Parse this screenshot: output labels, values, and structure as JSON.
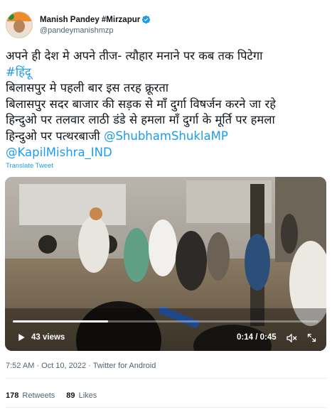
{
  "author": {
    "display_name": "Manish Pandey #Mirzapur",
    "handle": "@pandeymanishmzp",
    "verified_icon": "verified-badge-icon",
    "verified_color": "#1d9bf0"
  },
  "tweet": {
    "line1": "अपने ही देश मे अपने तीज- त्यौहार मनाने पर कब तक पिटेगा",
    "hashtag": "#हिंदू",
    "line3": "बिलासपुर मे पहली बार इस तरह क्रूरता",
    "line4": "बिलासपुर सदर बाजार की सड़क से माँ दुर्गा विषर्जन करने जा रहे",
    "line5": "हिन्दुओ पर तलवार लाठी डंडे से हमला माँ दुर्गा के मूर्ति पर हमला",
    "line6_text": "हिन्दुओ पर पत्थरबाजी ",
    "mention1": "@ShubhamShuklaMP",
    "mention2": "@KapilMishra_IND",
    "translate_label": "Translate Tweet",
    "link_color": "#1d9bf0"
  },
  "video": {
    "views": "43 views",
    "time": "0:14 / 0:45",
    "progress": 0.311,
    "icons": [
      "play-icon",
      "speaker-muted-icon",
      "fullscreen-icon"
    ]
  },
  "meta": {
    "timestamp": "7:52 AM · Oct 10, 2022 · Twitter for Android"
  },
  "stats": {
    "retweets_count": "178",
    "retweets_label": "Retweets",
    "likes_count": "89",
    "likes_label": "Likes"
  }
}
